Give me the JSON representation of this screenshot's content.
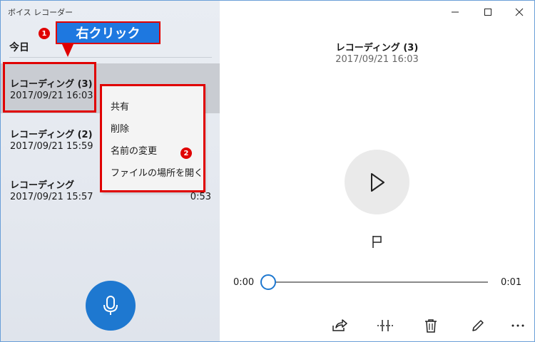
{
  "app": {
    "title": "ボイス レコーダー"
  },
  "list": {
    "section_title": "今日",
    "items": [
      {
        "name": "レコーディング (3)",
        "date": "2017/09/21 16:03",
        "duration": ""
      },
      {
        "name": "レコーディング (2)",
        "date": "2017/09/21 15:59",
        "duration": ""
      },
      {
        "name": "レコーディング",
        "date": "2017/09/21 15:57",
        "duration": "0:53"
      }
    ]
  },
  "context_menu": {
    "items": [
      "共有",
      "削除",
      "名前の変更",
      "ファイルの場所を開く"
    ]
  },
  "player": {
    "title": "レコーディング (3)",
    "date": "2017/09/21 16:03",
    "time_start": "0:00",
    "time_end": "0:01",
    "progress": 0
  },
  "annotations": {
    "callout_text": "右クリック",
    "badge1": "1",
    "badge2": "2"
  },
  "colors": {
    "accent": "#1e78d0",
    "annotation_red": "#e00000",
    "selection": "#c9ccd2"
  },
  "icons": {
    "mic": "microphone-icon",
    "play": "play-icon",
    "flag": "flag-marker-icon",
    "share": "share-icon",
    "trim": "trim-icon",
    "delete": "trash-icon",
    "rename": "pencil-icon",
    "more": "more-icon"
  }
}
